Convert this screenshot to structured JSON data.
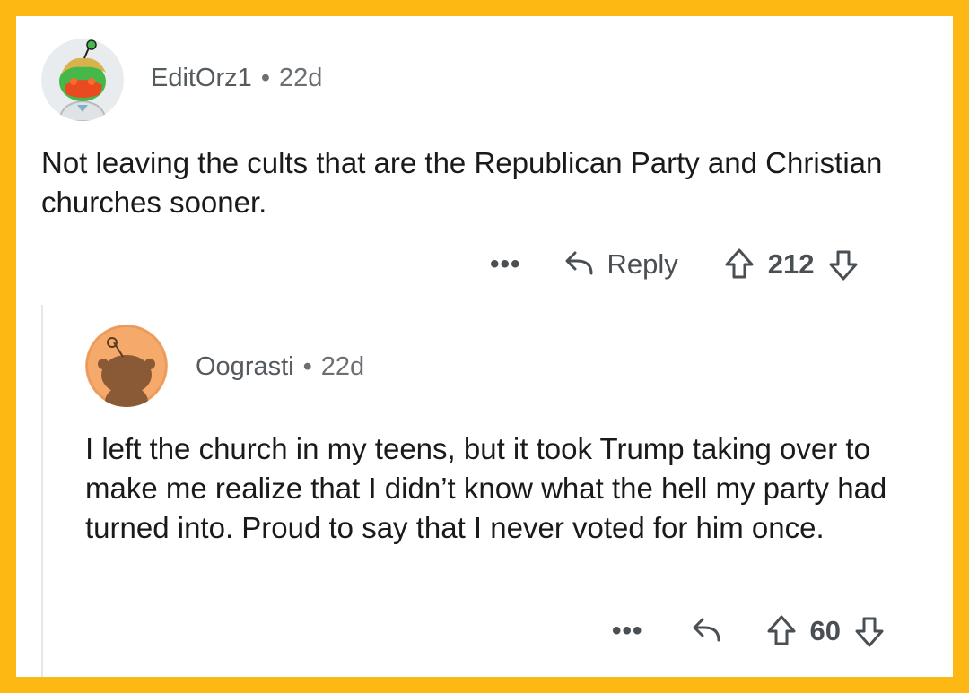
{
  "comments": [
    {
      "username": "EditOrz1",
      "separator": "•",
      "age": "22d",
      "avatar_icon": "snoo-avatar-green-icon",
      "text": "Not leaving the cults that are the Republican Party and Christian churches sooner.",
      "more_label": "•••",
      "reply_label": "Reply",
      "score": "212"
    },
    {
      "username": "Oograsti",
      "separator": "•",
      "age": "22d",
      "avatar_icon": "snoo-avatar-default-icon",
      "text": "I left the church in my teens, but it took Trump taking over to make me realize that I didn’t know what the hell my party had turned into. Proud to say that I never voted for him once.",
      "more_label": "•••",
      "score": "60"
    }
  ],
  "colors": {
    "frame": "#FDB813",
    "card": "#ffffff",
    "thread_line": "#e6e7e8",
    "text": "#1a1a1b",
    "muted": "#6b6f73",
    "default_avatar_bg": "#F5A96B"
  }
}
